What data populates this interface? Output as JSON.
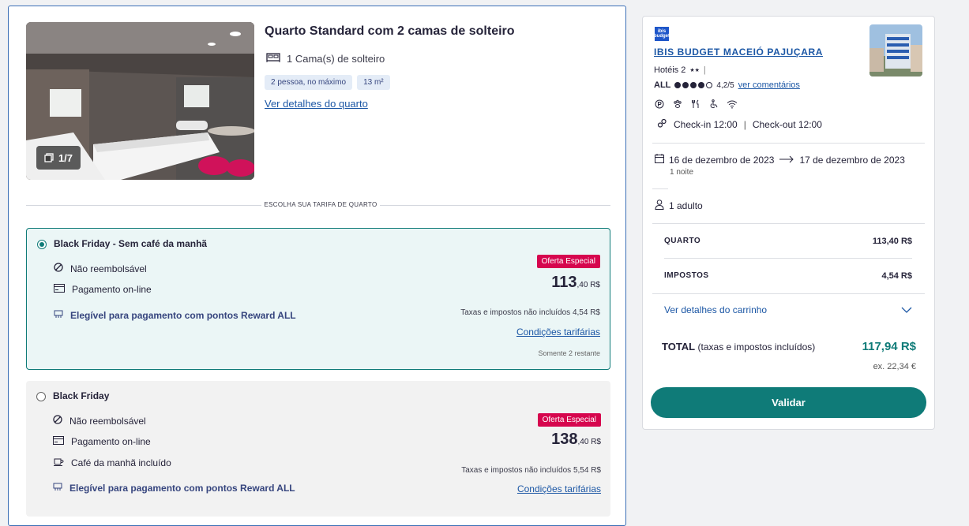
{
  "room": {
    "title": "Quarto Standard com 2 camas de solteiro",
    "photo_counter": "1/7",
    "bed": "1 Cama(s) de solteiro",
    "tags": [
      "2 pessoa, no máximo",
      "13 m²"
    ],
    "details_link": "Ver detalhes do quarto"
  },
  "rate_section_label": "ESCOLHA SUA TARIFA DE QUARTO",
  "rates": [
    {
      "name": "Black Friday - Sem café da manhã",
      "selected": true,
      "features": [
        "Não reembolsável",
        "Pagamento on-line"
      ],
      "reward": "Elegível para pagamento com pontos Reward ALL",
      "badge": "Oferta Especial",
      "price_main": "113",
      "price_cents": ",40 R$",
      "tax_note": "Taxas e impostos não incluídos 4,54 R$",
      "conditions_link": "Condições tarifárias",
      "remaining": "Somente 2 restante"
    },
    {
      "name": "Black Friday",
      "selected": false,
      "features": [
        "Não reembolsável",
        "Pagamento on-line",
        "Café da manhã incluído"
      ],
      "reward": "Elegível para pagamento com pontos Reward ALL",
      "badge": "Oferta Especial",
      "price_main": "138",
      "price_cents": ",40 R$",
      "tax_note": "Taxas e impostos não incluídos 5,54 R$",
      "conditions_link": "Condições tarifárias"
    }
  ],
  "summary": {
    "logo_text": "ibis budget",
    "hotel_name": "IBIS BUDGET MACEIÓ PAJUÇARA",
    "category": "Hotéis 2",
    "stars": "★★",
    "separator": "|",
    "all_logo": "ALL",
    "rating": "4,2/5",
    "rating_filled": 4,
    "rating_max": 5,
    "reviews_link": "ver comentários",
    "amenity_icons": [
      "parking-icon",
      "pets-icon",
      "restaurant-icon",
      "accessibility-icon",
      "wifi-icon"
    ],
    "checkin": "Check-in 12:00",
    "checkout": "Check-out 12:00",
    "date_from": "16 de dezembro de 2023",
    "date_to": "17 de dezembro de 2023",
    "nights": "1 noite",
    "guests": "1 adulto",
    "room_label": "QUARTO",
    "room_value": "113,40 R$",
    "tax_label": "IMPOSTOS",
    "tax_value": "4,54 R$",
    "cart_details": "Ver detalhes do carrinho",
    "total_label": "TOTAL",
    "total_sub": "(taxas e impostos incluídos)",
    "total_value": "117,94 R$",
    "excl": "ex. 22,34 €",
    "validate": "Validar"
  },
  "colors": {
    "accent": "#0f7b78",
    "link": "#1c57a5",
    "badge": "#d6064e",
    "panel_border": "#3b6fb6"
  }
}
